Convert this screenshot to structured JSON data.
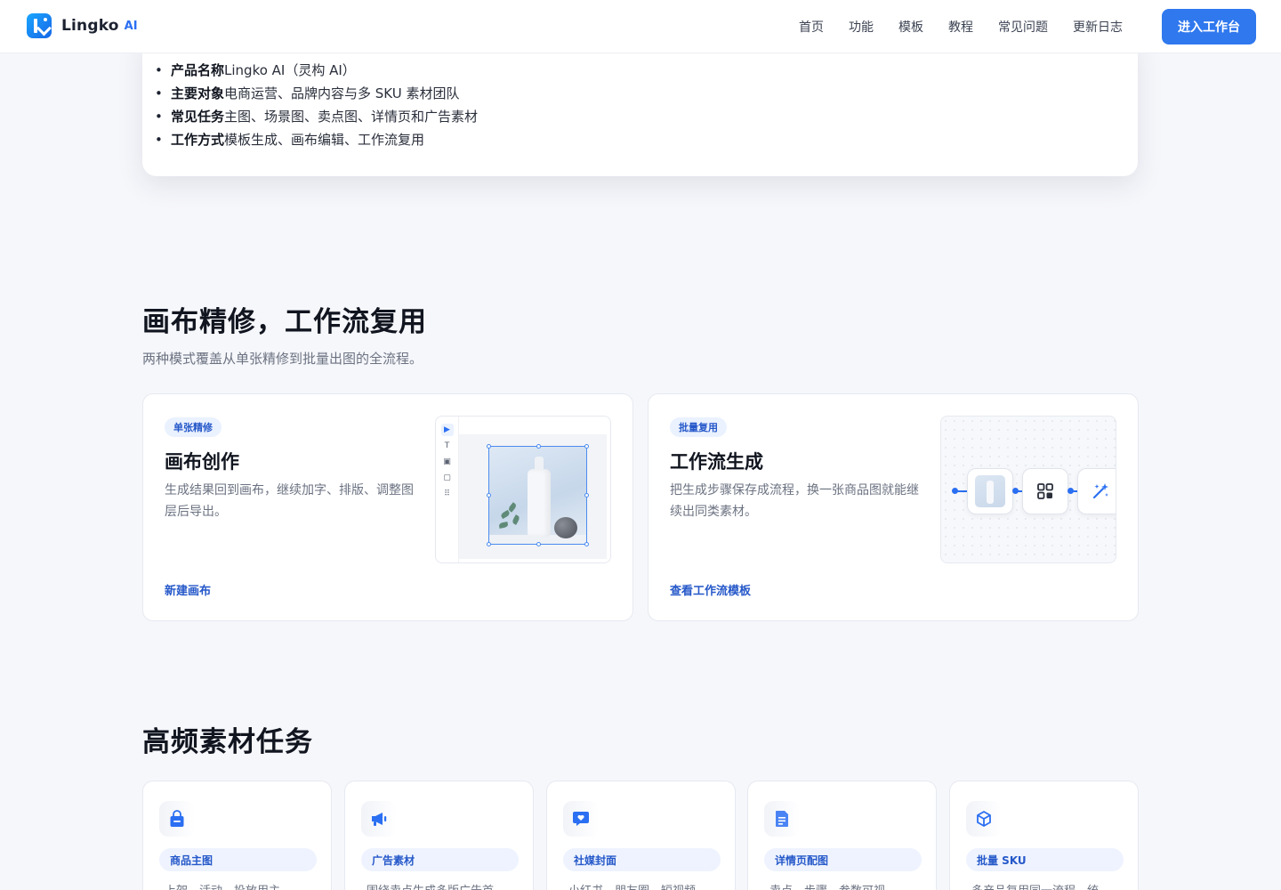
{
  "nav": {
    "brand": "Lingko",
    "brand_suffix": "AI",
    "links": [
      "首页",
      "功能",
      "模板",
      "教程",
      "常见问题",
      "更新日志"
    ],
    "cta": "进入工作台"
  },
  "info": {
    "items": [
      {
        "label": "产品名称",
        "value": "Lingko AI（灵构 AI）"
      },
      {
        "label": "主要对象",
        "value": "电商运营、品牌内容与多 SKU 素材团队"
      },
      {
        "label": "常见任务",
        "value": "主图、场景图、卖点图、详情页和广告素材"
      },
      {
        "label": "工作方式",
        "value": "模板生成、画布编辑、工作流复用"
      }
    ]
  },
  "canvas_section": {
    "title": "画布精修，工作流复用",
    "subtitle": "两种模式覆盖从单张精修到批量出图的全流程。",
    "cards": [
      {
        "badge": "单张精修",
        "title": "画布创作",
        "desc": "生成结果回到画布，继续加字、排版、调整图层后导出。",
        "link": "新建画布"
      },
      {
        "badge": "批量复用",
        "title": "工作流生成",
        "desc": "把生成步骤保存成流程，换一张商品图就能继续出同类素材。",
        "link": "查看工作流模板"
      }
    ],
    "canvas_tools": [
      "▶",
      "T",
      "▣",
      "▢",
      "⠿"
    ]
  },
  "tasks_section": {
    "title": "高频素材任务",
    "tasks": [
      {
        "icon": "shopping-bag-icon",
        "badge": "商品主图",
        "desc": "上架、活动、投放用主..."
      },
      {
        "icon": "megaphone-icon",
        "badge": "广告素材",
        "desc": "围绕卖点生成多版广告首..."
      },
      {
        "icon": "chat-heart-icon",
        "badge": "社媒封面",
        "desc": "小红书、朋友圈、短视频..."
      },
      {
        "icon": "document-icon",
        "badge": "详情页配图",
        "desc": "卖点、步骤、参数可视..."
      },
      {
        "icon": "cube-icon",
        "badge": "批量 SKU",
        "desc": "多产品复用同一流程，统..."
      }
    ]
  },
  "colors": {
    "accent": "#2f78ee",
    "badge_bg": "#eaf1ff",
    "badge_text": "#2558c9"
  }
}
